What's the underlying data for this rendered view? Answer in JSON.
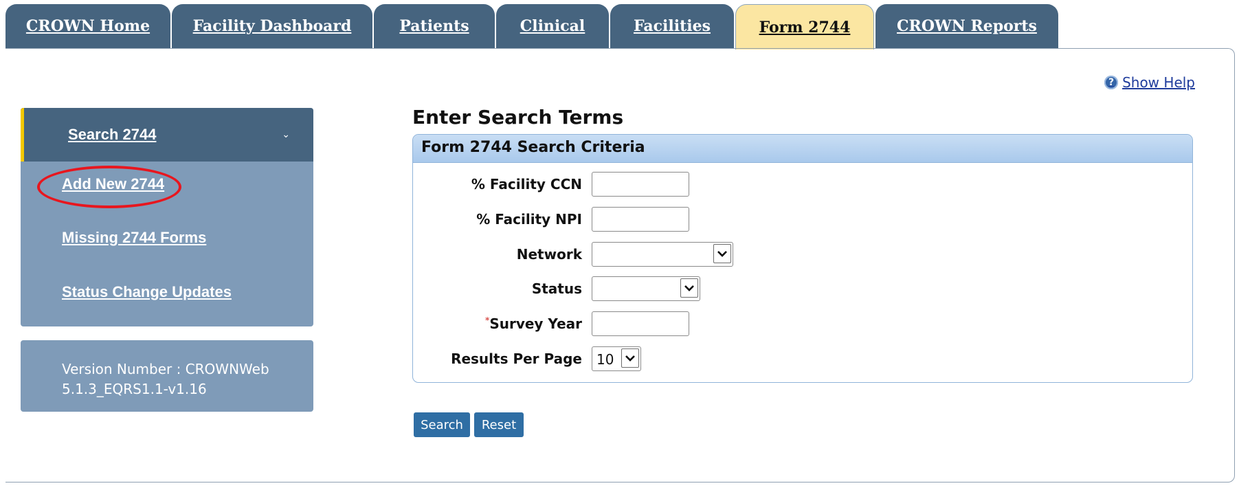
{
  "tabs": [
    {
      "label": "CROWN Home"
    },
    {
      "label": "Facility Dashboard"
    },
    {
      "label": "Patients"
    },
    {
      "label": "Clinical"
    },
    {
      "label": "Facilities"
    },
    {
      "label": "Form 2744"
    },
    {
      "label": "CROWN Reports"
    }
  ],
  "active_tab": "Form 2744",
  "help": {
    "label": " Show Help",
    "icon": "question-circle-icon"
  },
  "sidebar": {
    "header": {
      "label": "Search 2744",
      "icon": "chevron-down-icon"
    },
    "items": [
      {
        "label": "Add New 2744"
      },
      {
        "label": "Missing 2744 Forms"
      },
      {
        "label": "Status Change Updates"
      }
    ],
    "version_line1": "Version Number : CROWNWeb",
    "version_line2": "5.1.3_EQRS1.1-v1.16"
  },
  "main": {
    "title": "Enter Search Terms",
    "panel_title": "Form 2744 Search Criteria",
    "fields": {
      "ccn": {
        "label": "% Facility CCN",
        "value": ""
      },
      "npi": {
        "label": "% Facility NPI",
        "value": ""
      },
      "network": {
        "label": "Network",
        "value": ""
      },
      "status": {
        "label": "Status",
        "value": ""
      },
      "survey_year": {
        "label": "Survey Year",
        "required_mark": "*",
        "value": ""
      },
      "results_per_page": {
        "label": "Results Per Page",
        "value": "10"
      }
    },
    "buttons": {
      "search": "Search",
      "reset": "Reset"
    }
  },
  "colors": {
    "tab_bg": "#46647f",
    "active_tab_bg": "#fbe6a2",
    "sidebar_bg": "#7f9bb8",
    "button_bg": "#2f6ea4",
    "annotation_ring": "#e8161e"
  }
}
